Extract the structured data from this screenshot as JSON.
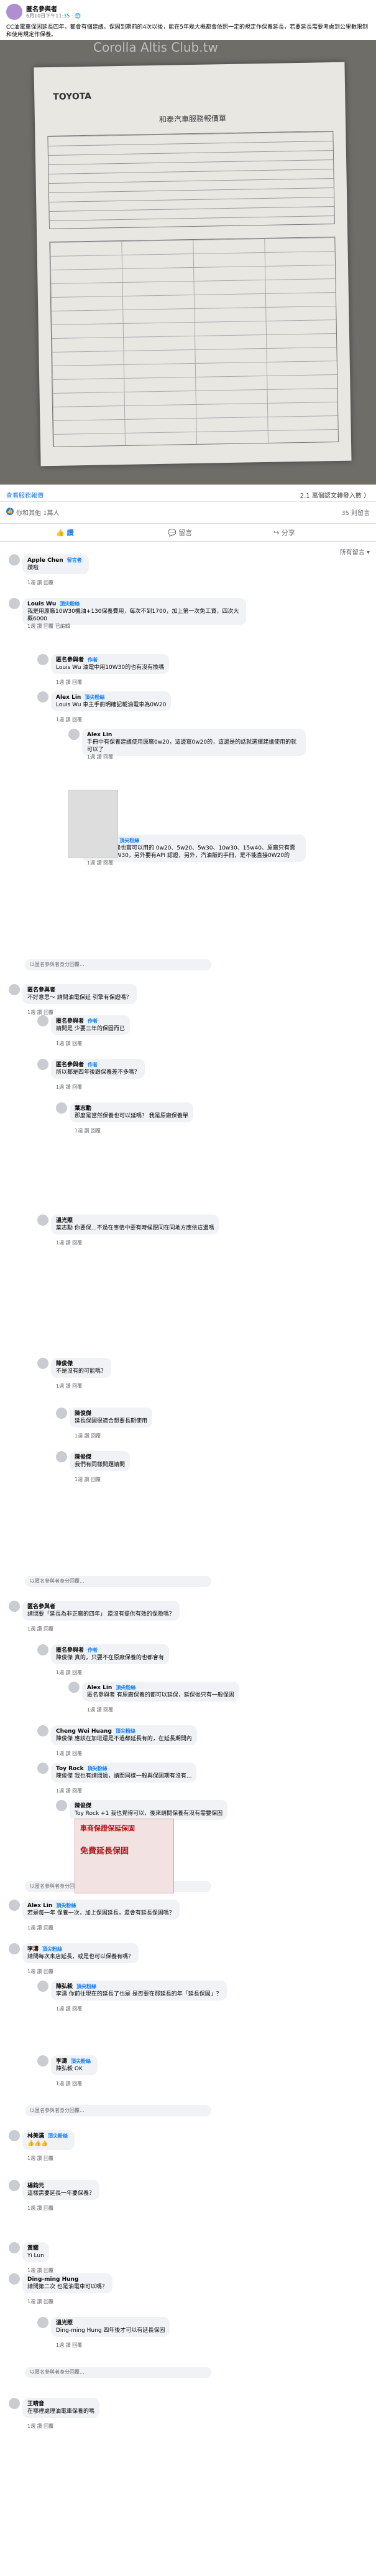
{
  "post": {
    "author": "匿名參與者",
    "time": "6月10日下午11:35 · 🌐",
    "text": "CC油電車保固延長四年，都會有個建議，保固到期前的4次以後，能在5年幾大概都會依照一定的規定作保養延長，若要延長需要考慮到公里數限制和使用規定作保養。",
    "photo_watermark": "Corolla Altis Club.tw",
    "photo_brand": "TOYOTA",
    "photo_doc_title": "和泰汽車服務報價單"
  },
  "links": {
    "left": "查看服務報價",
    "right": "2.1 萬個認文轉發入數 〉"
  },
  "stats": {
    "likes": "你和其他 1萬人",
    "comments": "35 則留言"
  },
  "actions": {
    "like": "讚",
    "comment": "留言",
    "share": "分享"
  },
  "sort": "所有留言 ▾",
  "comments": [
    {
      "name": "Apple Chen",
      "badge": "留言者",
      "text": "讚啦",
      "meta": "1週 讚 回覆"
    },
    {
      "name": "Louis Wu",
      "badge": "頂尖粉絲",
      "text": "我是用原廠10W30機油+130保養費用，每次不到1700，加上第一次免工資，四次大概6000",
      "meta": "1週 讚 回覆 已編輯"
    },
    {
      "name": "匿名參與者",
      "badge": "作者",
      "text": "Louis Wu 油電中用10W30的也有沒有換嗎",
      "meta": "1週 讚 回覆"
    },
    {
      "name": "Alex Lin",
      "badge": "頂尖粉絲",
      "text": "Louis Wu 車主手冊明確記載油電車為0W20",
      "meta": "1週 讚 回覆"
    },
    {
      "name": "Alex Lin",
      "badge": "",
      "text": "手冊中有保養建議使用原廠0w20，這邊寫0w20的，這邊是的話就選擇建議使用的就可以了",
      "meta": "1週 讚 回覆"
    },
    {
      "name": "Louis Wu",
      "badge": "頂尖粉絲",
      "text": "手冊上的附錄也寫可以用的 0w20、5w20、5w30、10w30、15w40、原廠只有賣0W20跟10W30，另外要有API 認證，另外，汽油版的手冊，是不能直接0W20的",
      "meta": "1週 讚 回覆"
    },
    {
      "name": "匿名參與者",
      "badge": "",
      "text": "不好意思～ 請問油電保延 引擎有保證嗎？",
      "meta": "1週 讚 回覆"
    },
    {
      "name": "匿名參與者",
      "badge": "作者",
      "text": "請問是 少要三年的保固而已",
      "meta": "1週 讚 回覆"
    },
    {
      "name": "匿名參與者",
      "badge": "作者",
      "text": "所以都是四年後跟保養差不多嗎？",
      "meta": "1週 讚 回覆"
    },
    {
      "name": "葉志勳",
      "badge": "",
      "text": "那麼是當然保養也可以延嗎？ 我是原廠保養單",
      "meta": "1週 讚 回覆"
    },
    {
      "name": "溫光照",
      "badge": "",
      "text": "葉志勳 你要保...不過在事情中要有時候跟同在同地方應依這邊嗎",
      "meta": "1週 讚 回覆"
    },
    {
      "name": "陳俊傑",
      "badge": "",
      "text": "不是沒有的可能嗎？",
      "meta": "1週 讚 回覆"
    },
    {
      "name": "陳俊傑",
      "badge": "",
      "text": "延長保固很適合想要長期使用",
      "meta": "1週 讚 回覆"
    },
    {
      "name": "陳俊傑",
      "badge": "",
      "text": "我們有同樣問題請問",
      "meta": "1週 讚 回覆"
    },
    {
      "name": "匿名參與者",
      "badge": "",
      "text": "請問要「延長為非正廠的四年」 還沒有提供有效的保險嗎？",
      "meta": "1週 讚 回覆"
    },
    {
      "name": "匿名參與者",
      "badge": "作者",
      "text": "陳俊傑 真的，只要不在原廠保養的也都會有",
      "meta": "1週 讚 回覆"
    },
    {
      "name": "Alex Lin",
      "badge": "頂尖粉絲",
      "text": "匿名參與者 有原廠保養的都可以延保，延保後只有一般保固",
      "meta": "1週 讚 回覆"
    },
    {
      "name": "Cheng Wei Huang",
      "badge": "頂尖粉絲",
      "text": "陳俊傑 應該在加班還是不過都延長有的，在延長期間內",
      "meta": "1週 讚 回覆"
    },
    {
      "name": "Toy Rock",
      "badge": "頂尖粉絲",
      "text": "陳俊傑 我也有請問過，請問同樣一般與保固期有沒有...",
      "meta": "1週 讚 回覆"
    },
    {
      "name": "陳俊傑",
      "badge": "",
      "text": "Toy Rock +1 我也覺得可以，後來請問保養有沒有需要保固",
      "meta": "1週 讚 回覆"
    },
    {
      "name": "Alex Lin",
      "badge": "頂尖粉絲",
      "text": "若是每一年 保養一次，加上保固延長，還會有延長保固嗎？",
      "meta": "1週 讚 回覆"
    },
    {
      "name": "李濤",
      "badge": "頂尖粉絲",
      "text": "請問每次來店延長，或是也可以保養有嗎？",
      "meta": "1週 讚 回覆"
    },
    {
      "name": "陳弘毅",
      "badge": "頂尖粉絲",
      "text": "李濤 你前往現在的延長了也是 是否要在那延長的年「延長保固」？",
      "meta": "1週 讚 回覆"
    },
    {
      "name": "李濤",
      "badge": "頂尖粉絲",
      "text": "陳弘毅 OK",
      "meta": "1週 讚 回覆"
    },
    {
      "name": "林美滿",
      "badge": "頂尖粉絲",
      "text": "👍👍👍",
      "meta": "1週 讚 回覆"
    },
    {
      "name": "楊鈞元",
      "badge": "",
      "text": "這樣需要延長一年要保養？",
      "meta": "1週 讚 回覆"
    },
    {
      "name": "黃耀",
      "badge": "",
      "text": "Yi Lun",
      "meta": "1週 讚 回覆"
    },
    {
      "name": "Ding-ming Hung",
      "badge": "",
      "text": "請問第二次 也是油電車可以嗎？",
      "meta": "1週 讚 回覆"
    },
    {
      "name": "溫光照",
      "badge": "",
      "text": "Ding-ming Hung 四年後才可以有延長保固",
      "meta": "1週 讚 回覆"
    },
    {
      "name": "王晴音",
      "badge": "",
      "text": "在哪裡處理油電車保養的嗎",
      "meta": "1週 讚 回覆"
    }
  ],
  "reply_placeholder": "以匿名參與者身分回覆...",
  "promo": {
    "title": "車商保證保延保固",
    "big": "免費延長保固"
  }
}
